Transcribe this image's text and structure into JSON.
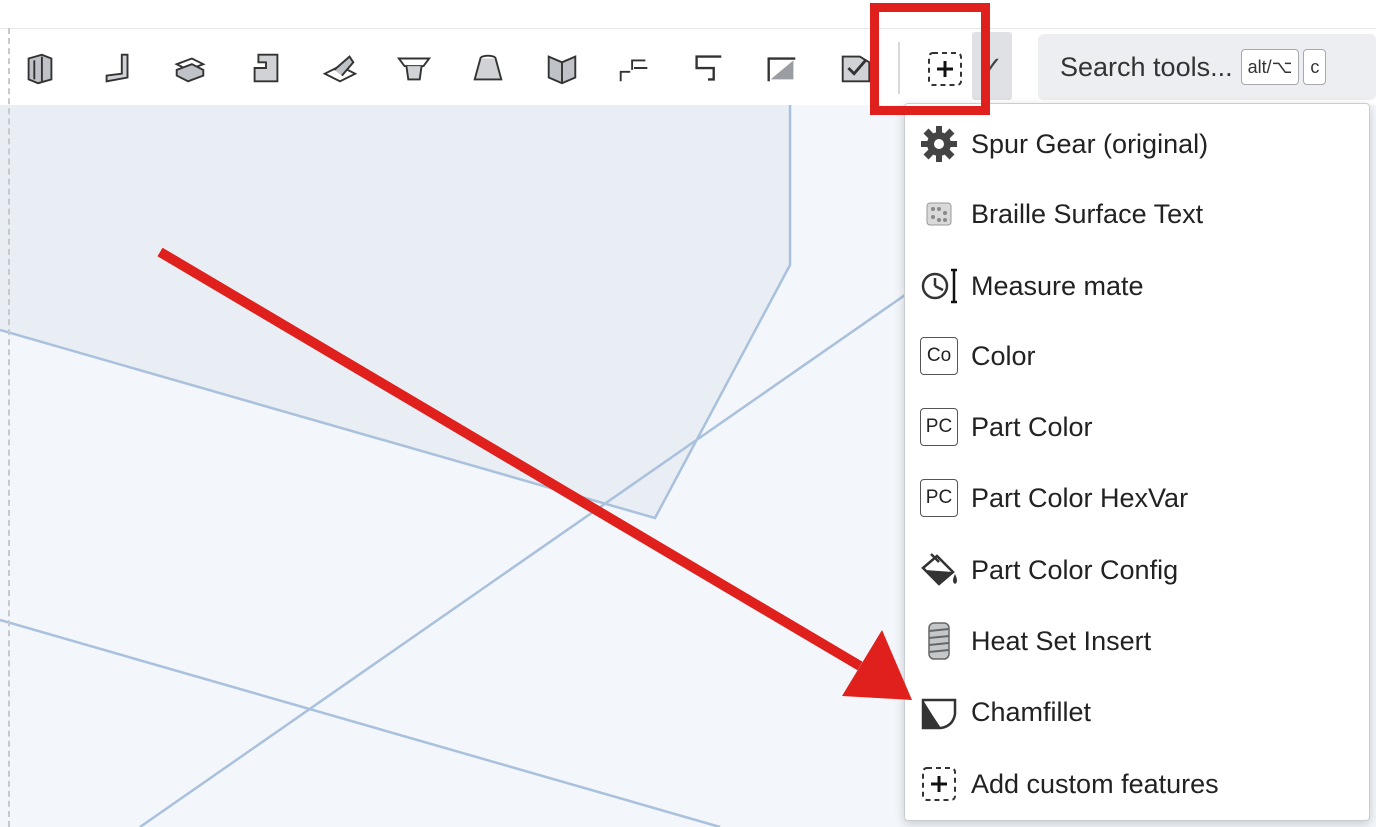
{
  "toolbar": {
    "tools": [
      "extrude-icon",
      "flange-icon",
      "sheet-metal-icon",
      "bracket-icon",
      "fold-icon",
      "loft-icon",
      "frustum-icon",
      "shell-icon",
      "jog-icon",
      "bend-relief-icon",
      "corner-icon",
      "finish-icon"
    ],
    "custom_feature_icon": "add-custom-feature-icon",
    "dropdown_glyph": "✓"
  },
  "search": {
    "placeholder": "Search tools...",
    "shortcut_1": "alt/⌥",
    "shortcut_2": "c"
  },
  "menu": {
    "items": [
      {
        "label": "Spur Gear (original)",
        "icon": "gear-icon"
      },
      {
        "label": "Braille Surface Text",
        "icon": "braille-icon"
      },
      {
        "label": "Measure mate",
        "icon": "measure-icon"
      },
      {
        "label": "Color",
        "icon": "text-icon",
        "icon_text": "Co"
      },
      {
        "label": "Part Color",
        "icon": "text-icon",
        "icon_text": "PC"
      },
      {
        "label": "Part Color HexVar",
        "icon": "text-icon",
        "icon_text": "PC"
      },
      {
        "label": "Part Color Config",
        "icon": "paint-bucket-icon"
      },
      {
        "label": "Heat Set Insert",
        "icon": "insert-icon"
      },
      {
        "label": "Chamfillet",
        "icon": "chamfillet-icon"
      },
      {
        "label": "Add custom features",
        "icon": "add-custom-feature-icon"
      }
    ]
  },
  "colors": {
    "annotation": "#e0201c",
    "viewport": "#f3f6fa",
    "sketch_lines": "#a9c1dd"
  }
}
